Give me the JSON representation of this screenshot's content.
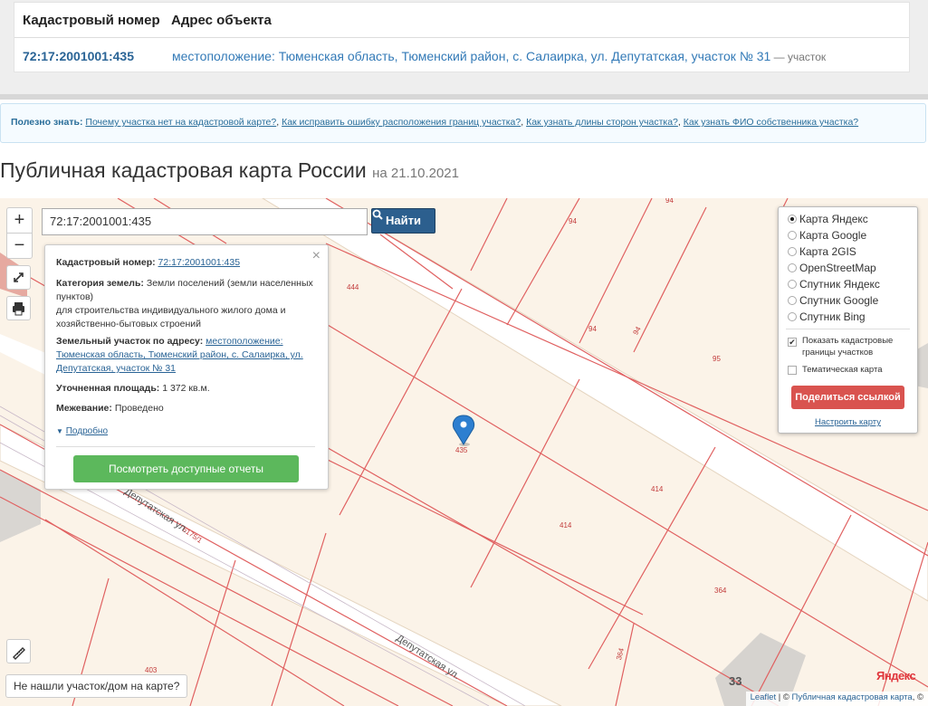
{
  "table": {
    "header_cad": "Кадастровый номер",
    "header_addr": "Адрес объекта",
    "cad_number": "72:17:2001001:435",
    "address": "местоположение: Тюменская область, Тюменский район, с. Салаирка, ул. Депутатская, участок № 31",
    "address_type": " — участок"
  },
  "useful": {
    "label": "Полезно знать:",
    "links": [
      "Почему участка нет на кадастровой карте?",
      "Как исправить ошибку расположения границ участка?",
      "Как узнать длины сторон участка?",
      "Как узнать ФИО собственника участка?"
    ]
  },
  "page": {
    "title": "Публичная кадастровая карта России",
    "date": "на 21.10.2021"
  },
  "search": {
    "value": "72:17:2001001:435",
    "button": "Найти"
  },
  "zoom": {
    "in": "+",
    "out": "−"
  },
  "popup": {
    "cad_label": "Кадастровый номер:",
    "cad_value": "72:17:2001001:435",
    "cat_label": "Категория земель:",
    "cat_value": "Земли поселений (земли населенных пунктов)",
    "cat_use": "для строительства индивидуального жилого дома и хозяйственно-бытовых строений",
    "addr_label": "Земельный участок по адресу:",
    "addr_value": "местоположение: Тюменская область, Тюменский район, с. Салаирка, ул. Депутатская, участок № 31",
    "area_label": "Уточненная площадь:",
    "area_value": "1 372 кв.м.",
    "survey_label": "Межевание:",
    "survey_value": "Проведено",
    "more": "Подробно",
    "reports_button": "Посмотреть доступные отчеты",
    "close": "×"
  },
  "layers": {
    "options": [
      "Карта Яндекс",
      "Карта Google",
      "Карта 2GIS",
      "OpenStreetMap",
      "Спутник Яндекс",
      "Спутник Google",
      "Спутник Bing"
    ],
    "selected": "Карта Яндекс",
    "show_borders": "Показать кадастровые границы участков",
    "show_borders_checked": true,
    "thematic": "Тематическая карта",
    "thematic_checked": false,
    "share_button": "Поделиться ссылкой",
    "setup_link": "Настроить карту"
  },
  "map": {
    "labels": {
      "l94a": "94",
      "l94b": "94",
      "l94c": "94",
      "l95": "95",
      "l444": "444",
      "l435": "435",
      "l414a": "414",
      "l414b": "414",
      "l364a": "364",
      "l364b": "364",
      "l403": "403",
      "l6175": "6175/1",
      "l33": "33"
    },
    "streets": {
      "s1": "Депутатская ул.",
      "s2": "Депутатская ул."
    },
    "not_found": "Не нашли участок/дом на карте?",
    "provider": "Яндекс",
    "attribution": {
      "leaflet": "Leaflet",
      "sep": " | © ",
      "pkk": "Публичная кадастровая карта",
      "tail": ", ©"
    }
  },
  "colors": {
    "accent": "#2c5f8e",
    "parcel_line": "#e06060",
    "report_btn": "#5cb85c",
    "share_btn": "#d9534f"
  }
}
